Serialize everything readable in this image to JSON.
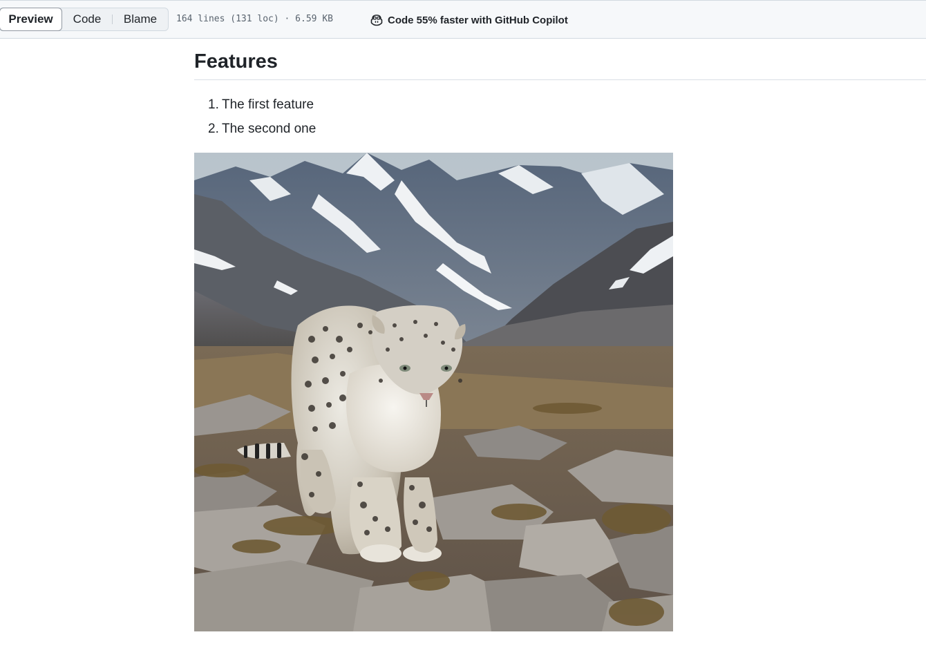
{
  "toolbar": {
    "tabs": [
      {
        "label": "Preview",
        "active": true
      },
      {
        "label": "Code",
        "active": false
      },
      {
        "label": "Blame",
        "active": false
      }
    ],
    "file_meta": "164 lines (131 loc) · 6.59 KB",
    "copilot": {
      "icon": "copilot-icon",
      "label": "Code 55% faster with GitHub Copilot"
    }
  },
  "content": {
    "heading": "Features",
    "list": [
      {
        "number": "1.",
        "text": "The first feature"
      },
      {
        "number": "2.",
        "text": "The second one"
      }
    ],
    "image": {
      "subject": "snow-leopard-photo"
    }
  },
  "colors": {
    "toolbar_bg": "#f6f8fa",
    "border": "#d1d9e0",
    "text": "#1f2328",
    "muted": "#59636e"
  }
}
